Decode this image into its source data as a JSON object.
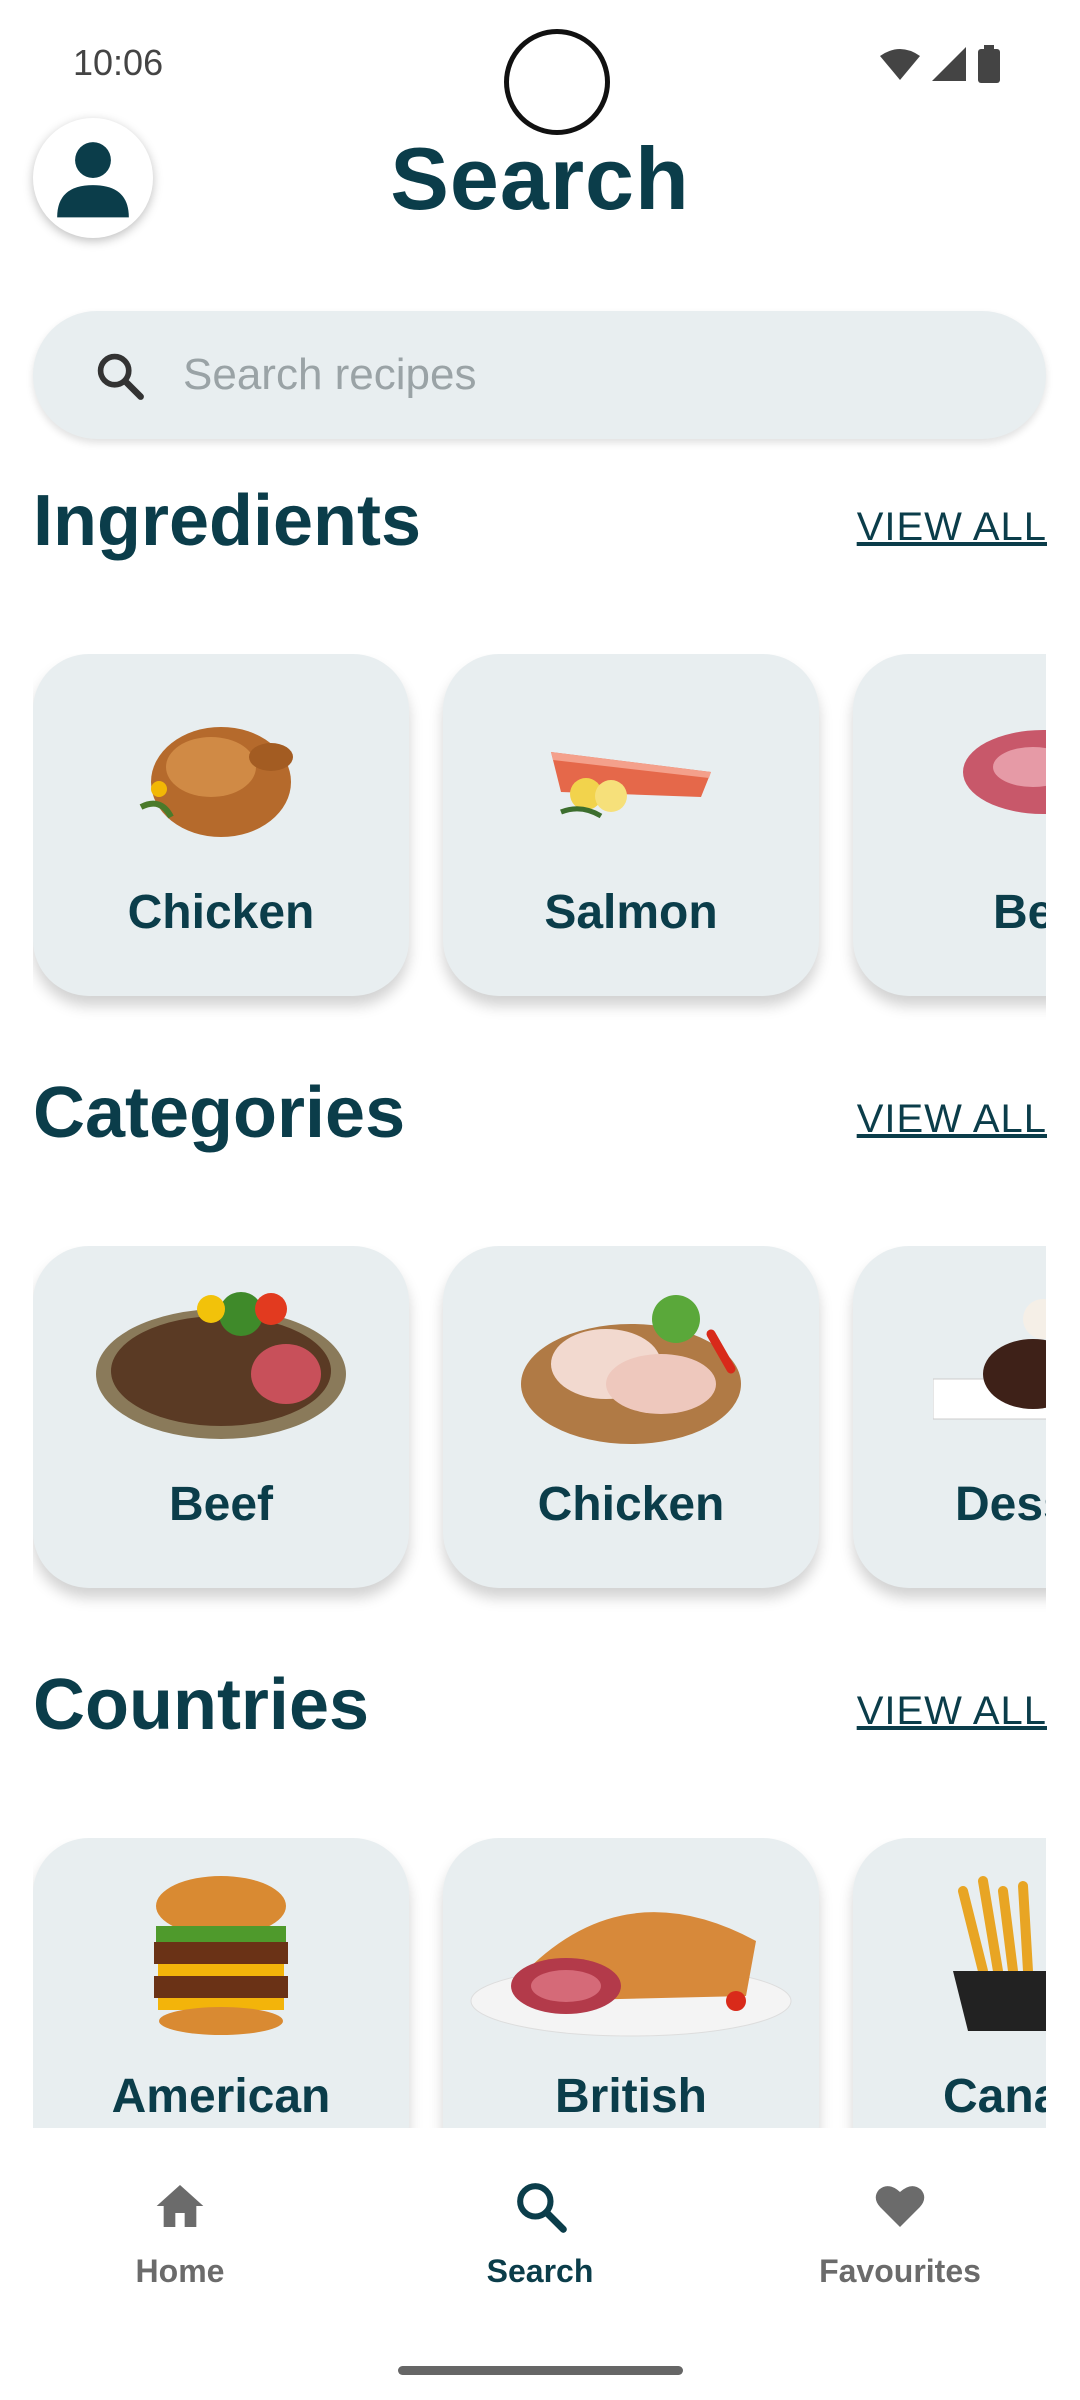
{
  "status": {
    "time": "10:06"
  },
  "header": {
    "title": "Search"
  },
  "search": {
    "placeholder": "Search recipes"
  },
  "sections": {
    "ingredients": {
      "title": "Ingredients",
      "view_all": "VIEW ALL",
      "items": [
        "Chicken",
        "Salmon",
        "Be"
      ]
    },
    "categories": {
      "title": "Categories",
      "view_all": "VIEW ALL",
      "items": [
        "Beef",
        "Chicken",
        "Dess"
      ]
    },
    "countries": {
      "title": "Countries",
      "view_all": "VIEW ALL",
      "items": [
        "American",
        "British",
        "Cana"
      ]
    }
  },
  "nav": {
    "items": [
      {
        "label": "Home",
        "icon": "home-icon"
      },
      {
        "label": "Search",
        "icon": "search-icon"
      },
      {
        "label": "Favourites",
        "icon": "heart-icon"
      }
    ],
    "active": "Search"
  },
  "colors": {
    "primary": "#0b3d4a",
    "card": "#e8eef0",
    "inactive": "#6b6b6b"
  }
}
